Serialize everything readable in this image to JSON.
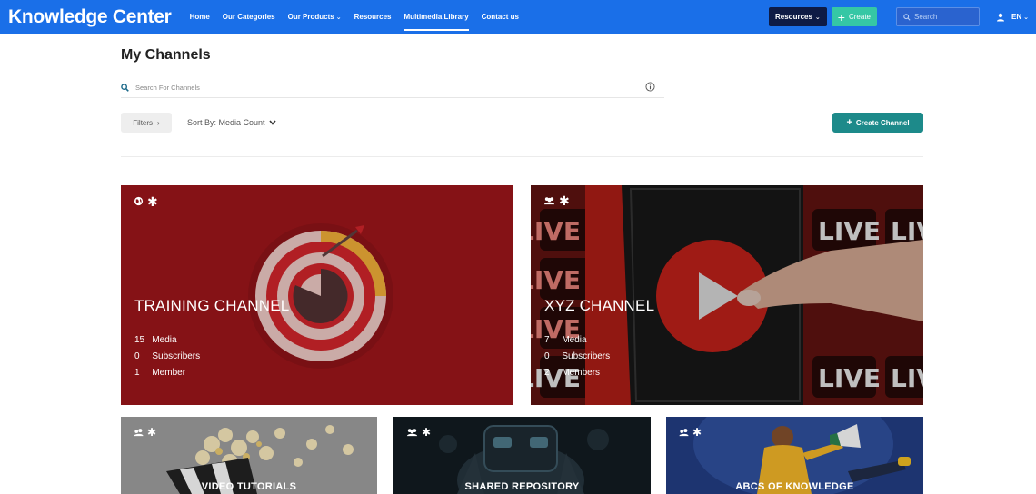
{
  "nav": {
    "brand": "Knowledge Center",
    "links": [
      {
        "label": "Home"
      },
      {
        "label": "Our Categories"
      },
      {
        "label": "Our Products"
      },
      {
        "label": "Resources"
      },
      {
        "label": "Multimedia Library"
      },
      {
        "label": "Contact us"
      }
    ],
    "resources_button": "Resources",
    "create_button": "Create",
    "search_placeholder": "Search",
    "language": "EN"
  },
  "page": {
    "title": "My Channels",
    "search_placeholder": "Search For Channels",
    "filters_label": "Filters",
    "sort_label": "Sort By: Media Count",
    "create_channel_label": "Create Channel"
  },
  "channels": [
    {
      "name": "TRAINING CHANNEL",
      "media_count": "15",
      "media_label": "Media",
      "subscriber_count": "0",
      "subscriber_label": "Subscribers",
      "member_count": "1",
      "member_label": "Member"
    },
    {
      "name": "XYZ CHANNEL",
      "media_count": "7",
      "media_label": "Media",
      "subscriber_count": "0",
      "subscriber_label": "Subscribers",
      "member_count": "2",
      "member_label": "Members",
      "bg_text": "LIVE"
    },
    {
      "name": "VIDEO TUTORIALS"
    },
    {
      "name": "SHARED REPOSITORY"
    },
    {
      "name": "ABCS OF KNOWLEDGE"
    }
  ],
  "colors": {
    "nav_bg": "#1a6fe8",
    "create_top": "#35c7a5",
    "create_channel": "#1d8a8a",
    "training_card": "#8a1418"
  },
  "icons": [
    "globe-icon",
    "asterisk-icon",
    "users-icon",
    "search-icon",
    "info-icon",
    "user-icon",
    "chevron-down-icon"
  ]
}
